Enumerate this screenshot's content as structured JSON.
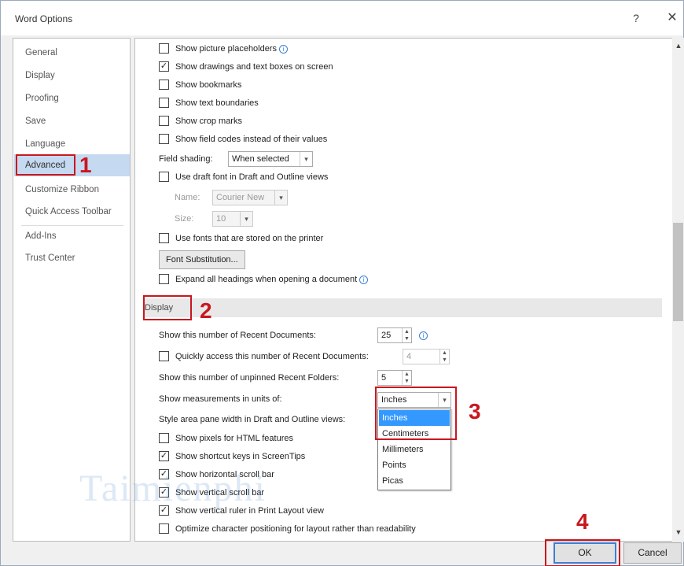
{
  "window": {
    "title": "Word Options",
    "help": "?",
    "close": "✕"
  },
  "nav": {
    "items": [
      "General",
      "Display",
      "Proofing",
      "Save",
      "Language",
      "Advanced",
      "Customize Ribbon",
      "Quick Access Toolbar",
      "Add-Ins",
      "Trust Center"
    ],
    "selected": "Advanced"
  },
  "content": {
    "opts_top": [
      {
        "label": "Show picture placeholders",
        "checked": false,
        "info": true
      },
      {
        "label": "Show drawings and text boxes on screen",
        "checked": true
      },
      {
        "label": "Show bookmarks",
        "checked": false
      },
      {
        "label": "Show text boundaries",
        "checked": false
      },
      {
        "label": "Show crop marks",
        "checked": false
      },
      {
        "label": "Show field codes instead of their values",
        "checked": false
      }
    ],
    "field_shading": {
      "label": "Field shading:",
      "value": "When selected"
    },
    "draft_font": {
      "label": "Use draft font in Draft and Outline views",
      "checked": false
    },
    "name": {
      "label": "Name:",
      "value": "Courier New"
    },
    "size": {
      "label": "Size:",
      "value": "10"
    },
    "printer_fonts": {
      "label": "Use fonts that are stored on the printer",
      "checked": false
    },
    "font_sub_button": "Font Substitution...",
    "expand_headings": {
      "label": "Expand all headings when opening a document",
      "checked": false
    },
    "display_section": "Display",
    "recent_docs": {
      "label": "Show this number of Recent Documents:",
      "value": "25"
    },
    "quick_access": {
      "label": "Quickly access this number of Recent Documents:",
      "value": "4",
      "checked": false
    },
    "unpinned_folders": {
      "label": "Show this number of unpinned Recent Folders:",
      "value": "5"
    },
    "units": {
      "label": "Show measurements in units of:",
      "value": "Inches",
      "options": [
        "Inches",
        "Centimeters",
        "Millimeters",
        "Points",
        "Picas"
      ],
      "highlighted": "Inches"
    },
    "style_area": {
      "label": "Style area pane width in Draft and Outline views:"
    },
    "opts_bottom": [
      {
        "label": "Show pixels for HTML features",
        "checked": false
      },
      {
        "label": "Show shortcut keys in ScreenTips",
        "checked": true
      },
      {
        "label": "Show horizontal scroll bar",
        "checked": true
      },
      {
        "label": "Show vertical scroll bar",
        "checked": true
      },
      {
        "label": "Show vertical ruler in Print Layout view",
        "checked": true
      },
      {
        "label": "Optimize character positioning for layout rather than readability",
        "checked": false
      }
    ]
  },
  "steps": [
    "1",
    "2",
    "3",
    "4"
  ],
  "watermark": "Taimienphi",
  "footer": {
    "ok": "OK",
    "cancel": "Cancel"
  },
  "colors": {
    "accent_red": "#c8171e",
    "selection_blue": "#3399ff",
    "nav_selected": "#c5d9f1"
  }
}
